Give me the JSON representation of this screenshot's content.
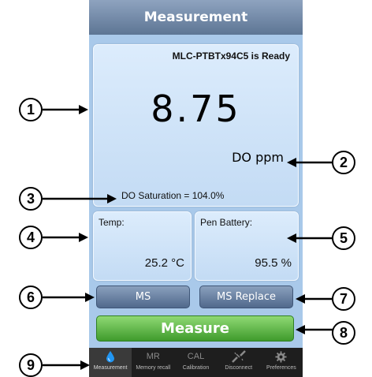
{
  "header": {
    "title": "Measurement"
  },
  "status": {
    "ready_text": "MLC-PTBTx94C5 is Ready"
  },
  "reading": {
    "value": "8.75",
    "unit": "DO ppm",
    "saturation": "DO Saturation = 104.0%"
  },
  "temp": {
    "label": "Temp:",
    "value": "25.2 °C"
  },
  "battery": {
    "label": "Pen Battery:",
    "value": "95.5 %"
  },
  "buttons": {
    "ms": "MS",
    "ms_replace": "MS Replace",
    "measure": "Measure"
  },
  "tabs": [
    {
      "label": "Measurement",
      "icon": "drop-icon",
      "icon_text": ""
    },
    {
      "label": "Memory recall",
      "icon": "mr-icon",
      "icon_text": "MR"
    },
    {
      "label": "Calibration",
      "icon": "cal-icon",
      "icon_text": "CAL"
    },
    {
      "label": "Disconnect",
      "icon": "disconnect-icon",
      "icon_text": ""
    },
    {
      "label": "Preferences",
      "icon": "gear-icon",
      "icon_text": ""
    }
  ],
  "callouts": [
    "1",
    "2",
    "3",
    "4",
    "5",
    "6",
    "7",
    "8",
    "9"
  ],
  "colors": {
    "accent_blue": "#1e88e5",
    "measure_green": "#4caf50",
    "panel": "#d3e6fa"
  }
}
